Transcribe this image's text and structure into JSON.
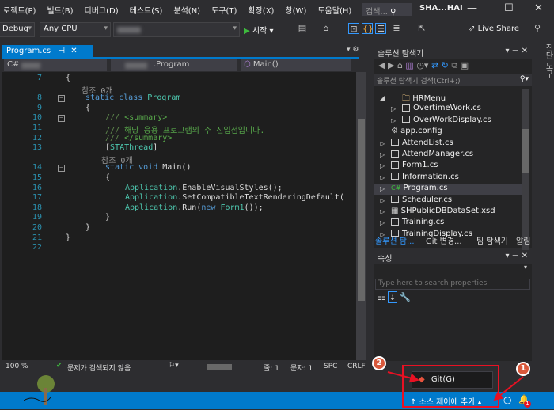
{
  "menu": [
    "로젝트(P)",
    "빌드(B)",
    "디버그(D)",
    "테스트(S)",
    "분석(N)",
    "도구(T)",
    "확장(X)",
    "창(W)",
    "도움말(H)"
  ],
  "search_placeholder": "검색...",
  "user": "SHA...HAI",
  "toolbar": {
    "config": "Debug",
    "platform": "Any CPU",
    "start": "시작",
    "live_share": "Live Share"
  },
  "tab": {
    "label": "Program.cs",
    "pin": "⊣",
    "close": "✕"
  },
  "nav": {
    "class": ".Program",
    "member": "Main()"
  },
  "code": [
    {
      "n": "7",
      "t": "{",
      "i": 0
    },
    {
      "ref": "참조 0개",
      "i": 1
    },
    {
      "n": "8",
      "t": "static class Program",
      "i": 1,
      "k": "class"
    },
    {
      "n": "9",
      "t": "{",
      "i": 1
    },
    {
      "n": "10",
      "t": "/// <summary>",
      "i": 2,
      "k": "cm"
    },
    {
      "n": "11",
      "t": "/// 해당 응용 프로그램의 주 진입점입니다.",
      "i": 2,
      "k": "cm"
    },
    {
      "n": "12",
      "t": "/// </summary>",
      "i": 2,
      "k": "cm"
    },
    {
      "n": "13",
      "t": "[STAThread]",
      "i": 2,
      "k": "attr"
    },
    {
      "ref": "참조 0개",
      "i": 2
    },
    {
      "n": "14",
      "t": "static void Main()",
      "i": 2,
      "k": "main"
    },
    {
      "n": "15",
      "t": "{",
      "i": 2
    },
    {
      "n": "16",
      "t": "Application.EnableVisualStyles();",
      "i": 3,
      "k": "app"
    },
    {
      "n": "17",
      "t": "Application.SetCompatibleTextRenderingDefault(",
      "i": 3,
      "k": "app"
    },
    {
      "n": "18",
      "t": "Application.Run(new Form1());",
      "i": 3,
      "k": "run"
    },
    {
      "n": "19",
      "t": "}",
      "i": 2
    },
    {
      "n": "20",
      "t": "}",
      "i": 1
    },
    {
      "n": "21",
      "t": "}",
      "i": 0
    },
    {
      "n": "22",
      "t": "",
      "i": 0
    }
  ],
  "editor_status": {
    "zoom": "100 %",
    "issues": "문제가 검색되지 않음",
    "line": "줄: 1",
    "col": "문자: 1",
    "spc": "SPC",
    "crlf": "CRLF"
  },
  "solution_explorer": {
    "title": "솔루션 탐색기",
    "search": "솔루션 탐색기 검색(Ctrl+;)",
    "items": [
      {
        "label": "HRMenu",
        "level": 1,
        "exp": "◢",
        "icon": "folder"
      },
      {
        "label": "OvertimeWork.cs",
        "level": 2,
        "exp": "▷",
        "icon": "form"
      },
      {
        "label": "OverWorkDisplay.cs",
        "level": 2,
        "exp": "▷",
        "icon": "form"
      },
      {
        "label": "app.config",
        "level": 1,
        "exp": "",
        "icon": "config"
      },
      {
        "label": "AttendList.cs",
        "level": 1,
        "exp": "▷",
        "icon": "form"
      },
      {
        "label": "AttendManager.cs",
        "level": 1,
        "exp": "▷",
        "icon": "form"
      },
      {
        "label": "Form1.cs",
        "level": 1,
        "exp": "▷",
        "icon": "form"
      },
      {
        "label": "Information.cs",
        "level": 1,
        "exp": "▷",
        "icon": "form"
      },
      {
        "label": "Program.cs",
        "level": 1,
        "exp": "▷",
        "icon": "csharp",
        "selected": true
      },
      {
        "label": "Scheduler.cs",
        "level": 1,
        "exp": "▷",
        "icon": "form"
      },
      {
        "label": "SHPublicDBDataSet.xsd",
        "level": 1,
        "exp": "▷",
        "icon": "dataset"
      },
      {
        "label": "Training.cs",
        "level": 1,
        "exp": "▷",
        "icon": "form"
      },
      {
        "label": "TrainingDisplay.cs",
        "level": 1,
        "exp": "▷",
        "icon": "form"
      }
    ],
    "tabs": [
      "솔루션 탐...",
      "Git 변경...",
      "팀 탐색기",
      "알림"
    ]
  },
  "properties": {
    "title": "속성",
    "search_placeholder": "Type here to search properties"
  },
  "right_strip": "진단 도구",
  "git_popup": "Git(G)",
  "source_control": "소스 제어에 추가",
  "notif_count": "1",
  "annotations": [
    "1",
    "2"
  ],
  "colors": {
    "accent": "#007acc",
    "annotation": "#e81123",
    "badge": "#d9583b"
  }
}
